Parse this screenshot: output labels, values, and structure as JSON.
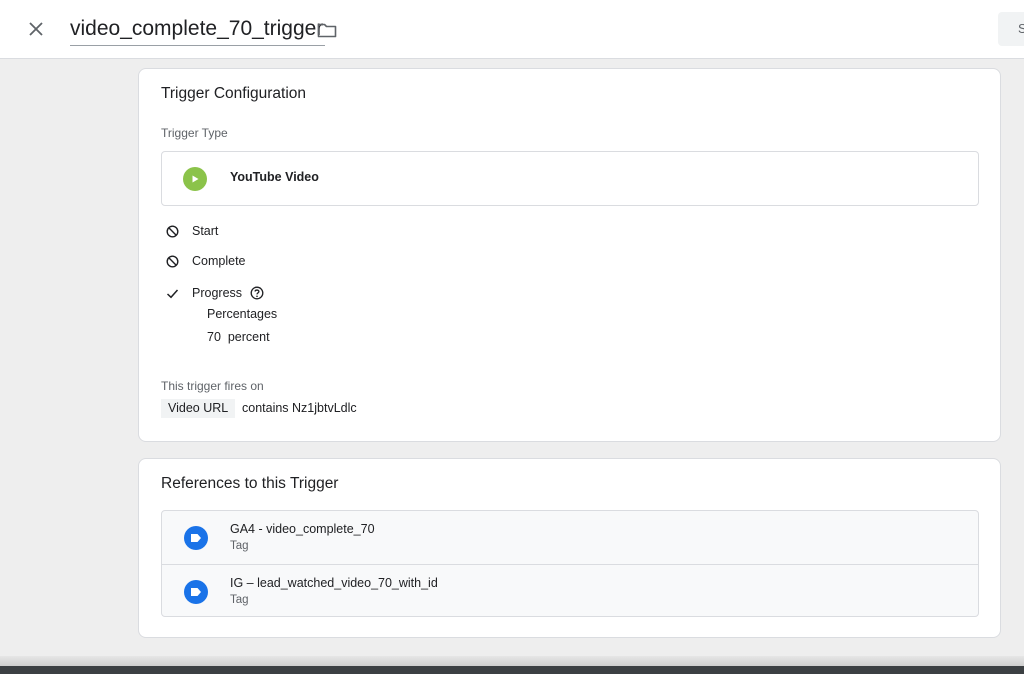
{
  "header": {
    "close_icon": "close-icon",
    "trigger_name": "video_complete_70_trigger",
    "folder_icon": "folder-icon",
    "save_label": "S"
  },
  "config": {
    "title": "Trigger Configuration",
    "trigger_type_label": "Trigger Type",
    "trigger_type": "YouTube Video",
    "trigger_type_icon": "play-icon",
    "options": [
      {
        "label": "Start",
        "state": "disabled",
        "icon": "block-icon"
      },
      {
        "label": "Complete",
        "state": "disabled",
        "icon": "block-icon"
      },
      {
        "label": "Progress",
        "state": "enabled",
        "icon": "check-icon"
      }
    ],
    "progress_mode": "Percentages",
    "progress_value": "70",
    "progress_unit": "percent",
    "fires_on_label": "This trigger fires on",
    "condition_variable": "Video URL",
    "condition_text": "contains Nz1jbtvLdlc"
  },
  "references": {
    "title": "References to this Trigger",
    "items": [
      {
        "name": "GA4 - video_complete_70",
        "type": "Tag",
        "icon": "tag-icon"
      },
      {
        "name": "IG – lead_watched_video_70_with_id",
        "type": "Tag",
        "icon": "tag-icon"
      }
    ]
  },
  "colors": {
    "youtube_icon": "#8bc34a",
    "tag_icon": "#1a73e8"
  }
}
